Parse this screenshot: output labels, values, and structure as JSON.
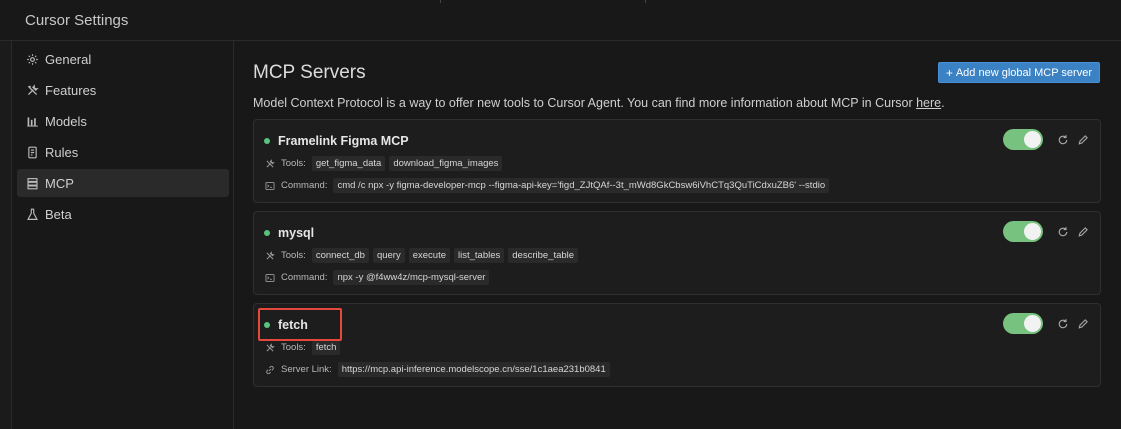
{
  "window": {
    "title": "Cursor Settings"
  },
  "sidebar": {
    "items": [
      {
        "label": "General",
        "icon": "gear-icon"
      },
      {
        "label": "Features",
        "icon": "tools-icon"
      },
      {
        "label": "Models",
        "icon": "bar-chart-icon"
      },
      {
        "label": "Rules",
        "icon": "document-icon"
      },
      {
        "label": "MCP",
        "icon": "server-icon",
        "active": true
      },
      {
        "label": "Beta",
        "icon": "flask-icon"
      }
    ]
  },
  "main": {
    "title": "MCP Servers",
    "add_button": "Add new global MCP server",
    "description": "Model Context Protocol is a way to offer new tools to Cursor Agent. You can find more information about MCP in Cursor ",
    "description_link": "here",
    "description_end": "."
  },
  "servers": [
    {
      "name": "Framelink Figma MCP",
      "status": "enabled",
      "tools_label": "Tools:",
      "tools": [
        "get_figma_data",
        "download_figma_images"
      ],
      "source_label": "Command:",
      "source_value": "cmd /c npx -y figma-developer-mcp --figma-api-key='figd_ZJtQAf--3t_mWd8GkCbsw6iVhCTq3QuTiCdxuZB6' --stdio"
    },
    {
      "name": "mysql",
      "status": "enabled",
      "tools_label": "Tools:",
      "tools": [
        "connect_db",
        "query",
        "execute",
        "list_tables",
        "describe_table"
      ],
      "source_label": "Command:",
      "source_value": "npx -y @f4ww4z/mcp-mysql-server"
    },
    {
      "name": "fetch",
      "status": "enabled",
      "tools_label": "Tools:",
      "tools": [
        "fetch"
      ],
      "source_label": "Server Link:",
      "source_value": "https://mcp.api-inference.modelscope.cn/sse/1c1aea231b0841"
    }
  ],
  "colors": {
    "accent": "#3b82c4",
    "toggle_on": "#78c27f",
    "status_dot": "#58c47e",
    "highlight": "#e5483c"
  }
}
